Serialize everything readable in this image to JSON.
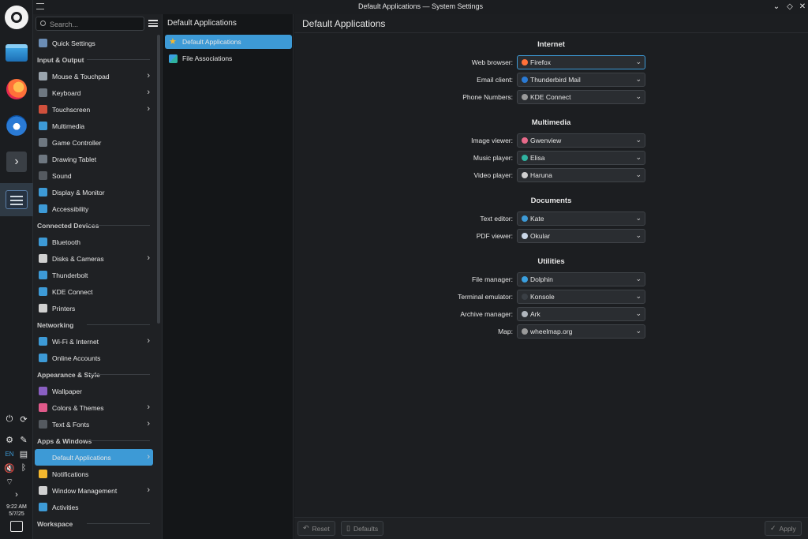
{
  "window": {
    "title": "Default Applications — System Settings"
  },
  "search": {
    "placeholder": "Search..."
  },
  "sidebar": {
    "quick": "Quick Settings",
    "sections": [
      {
        "header": "Input & Output",
        "items": [
          "Mouse & Touchpad",
          "Keyboard",
          "Touchscreen",
          "Multimedia",
          "Game Controller",
          "Drawing Tablet",
          "Sound",
          "Display & Monitor",
          "Accessibility"
        ]
      },
      {
        "header": "Connected Devices",
        "items": [
          "Bluetooth",
          "Disks & Cameras",
          "Thunderbolt",
          "KDE Connect",
          "Printers"
        ]
      },
      {
        "header": "Networking",
        "items": [
          "Wi-Fi & Internet",
          "Online Accounts"
        ]
      },
      {
        "header": "Appearance & Style",
        "items": [
          "Wallpaper",
          "Colors & Themes",
          "Text & Fonts"
        ]
      },
      {
        "header": "Apps & Windows",
        "items": [
          "Default Applications",
          "Notifications",
          "Window Management",
          "Activities"
        ]
      },
      {
        "header": "Workspace",
        "items": []
      }
    ]
  },
  "subpanel": {
    "title": "Default Applications",
    "items": [
      "Default Applications",
      "File Associations"
    ]
  },
  "main": {
    "title": "Default Applications",
    "sections": [
      {
        "title": "Internet",
        "rows": [
          {
            "label": "Web browser:",
            "value": "Firefox",
            "color": "#ff7139"
          },
          {
            "label": "Email client:",
            "value": "Thunderbird Mail",
            "color": "#2a7ad4"
          },
          {
            "label": "Phone Numbers:",
            "value": "KDE Connect",
            "color": "#9a9a9a"
          }
        ]
      },
      {
        "title": "Multimedia",
        "rows": [
          {
            "label": "Image viewer:",
            "value": "Gwenview",
            "color": "#e86a8a"
          },
          {
            "label": "Music player:",
            "value": "Elisa",
            "color": "#2fb2a0"
          },
          {
            "label": "Video player:",
            "value": "Haruna",
            "color": "#d0d0d0"
          }
        ]
      },
      {
        "title": "Documents",
        "rows": [
          {
            "label": "Text editor:",
            "value": "Kate",
            "color": "#3d9ad6"
          },
          {
            "label": "PDF viewer:",
            "value": "Okular",
            "color": "#c9d6e6"
          }
        ]
      },
      {
        "title": "Utilities",
        "rows": [
          {
            "label": "File manager:",
            "value": "Dolphin",
            "color": "#3aa0e0"
          },
          {
            "label": "Terminal emulator:",
            "value": "Konsole",
            "color": "#3a3f45"
          },
          {
            "label": "Archive manager:",
            "value": "Ark",
            "color": "#b0b6bd"
          },
          {
            "label": "Map:",
            "value": "wheelmap.org",
            "color": "#9a9a9a"
          }
        ]
      }
    ]
  },
  "footer": {
    "reset": "Reset",
    "defaults": "Defaults",
    "apply": "Apply"
  },
  "panel": {
    "time": "9:22 AM",
    "date": "5/7/25",
    "lang": "EN"
  },
  "colors": {
    "accent": "#3d9ad6",
    "bg": "#1c1e21",
    "sidebar": "#1f2124"
  }
}
